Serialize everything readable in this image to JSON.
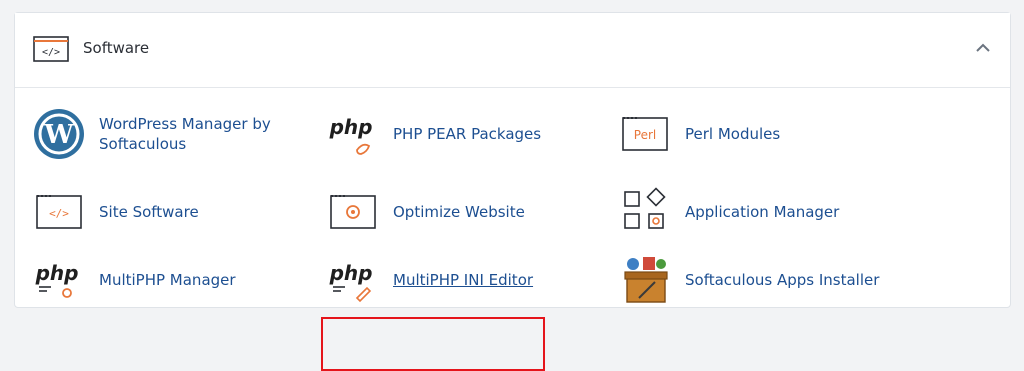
{
  "section": {
    "title": "Software",
    "header_icon": "code-window-icon",
    "collapse_icon": "chevron-up-icon"
  },
  "items": [
    {
      "label": "WordPress Manager by Softaculous",
      "icon": "wordpress-icon"
    },
    {
      "label": "PHP PEAR Packages",
      "icon": "php-pear-icon"
    },
    {
      "label": "Perl Modules",
      "icon": "perl-icon",
      "icon_text": "Perl"
    },
    {
      "label": "Site Software",
      "icon": "code-window-icon"
    },
    {
      "label": "Optimize Website",
      "icon": "gear-window-icon"
    },
    {
      "label": "Application Manager",
      "icon": "app-grid-icon"
    },
    {
      "label": "MultiPHP Manager",
      "icon": "php-manager-icon"
    },
    {
      "label": "MultiPHP INI Editor",
      "icon": "php-ini-icon"
    },
    {
      "label": "Softaculous Apps Installer",
      "icon": "softaculous-icon"
    }
  ],
  "colors": {
    "link": "#1d4f91",
    "accent": "#e8773a",
    "highlight": "#e5141b"
  }
}
